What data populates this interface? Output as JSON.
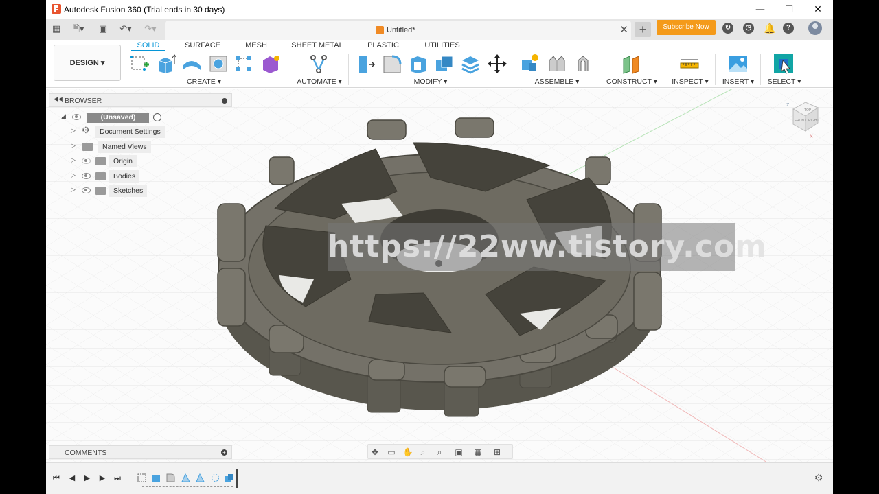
{
  "window": {
    "title": "Autodesk Fusion 360 (Trial ends in 30 days)",
    "minimize": "—",
    "maximize": "☐",
    "close": "✕"
  },
  "tabrow": {
    "doc_name": "Untitled*",
    "subscribe_label": "Subscribe Now",
    "new_tab": "+"
  },
  "toolbar": {
    "design_label": "DESIGN ▾",
    "tabs": [
      "SOLID",
      "SURFACE",
      "MESH",
      "SHEET METAL",
      "PLASTIC",
      "UTILITIES"
    ],
    "active_tab": "SOLID",
    "groups": [
      "CREATE ▾",
      "AUTOMATE ▾",
      "MODIFY ▾",
      "ASSEMBLE ▾",
      "CONSTRUCT ▾",
      "INSPECT ▾",
      "INSERT ▾",
      "SELECT ▾"
    ]
  },
  "browser": {
    "header": "BROWSER",
    "root": "(Unsaved)",
    "items": [
      "Document Settings",
      "Named Views",
      "Origin",
      "Bodies",
      "Sketches"
    ]
  },
  "comments": {
    "label": "COMMENTS"
  },
  "viewcube": {
    "top": "TOP",
    "front": "FRONT",
    "right": "RIGHT"
  },
  "watermark": "https://22ww.tistory.com",
  "colors": {
    "accent": "#0696d7",
    "subscribe": "#f49a1a",
    "model": "#6f6c62"
  }
}
